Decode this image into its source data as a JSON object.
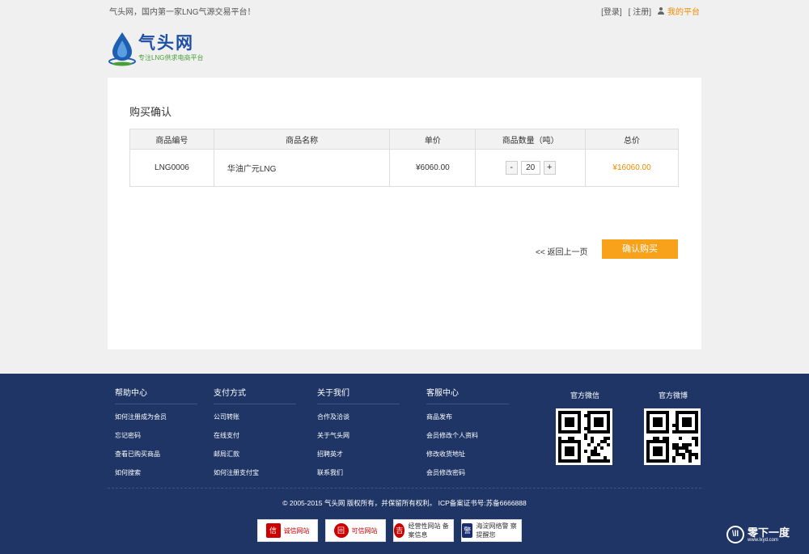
{
  "topbar": {
    "slogan": "气头网，国内第一家LNG气源交易平台！",
    "login": "[登录]",
    "register": "[ 注册]",
    "my_platform": "我的平台"
  },
  "logo": {
    "brand": "气头网",
    "tagline": "专注LNG供求电商平台"
  },
  "order": {
    "title": "购买确认",
    "columns": [
      "商品编号",
      "商品名称",
      "单价",
      "商品数量（吨）",
      "总价"
    ],
    "rows": [
      {
        "code": "LNG0006",
        "name": "华油广元LNG",
        "unit_price": "¥6060.00",
        "quantity": "20",
        "total": "¥16060.00"
      }
    ],
    "decrement": "-",
    "increment": "+",
    "back_label": "<<  返回上一页",
    "confirm_label": "确认购买"
  },
  "footer": {
    "help": {
      "title": "帮助中心",
      "items": [
        "如何注册成为会员",
        "忘记密码",
        "查看已购买商品",
        "如何搜索"
      ]
    },
    "payment": {
      "title": "支付方式",
      "items": [
        "公司转账",
        "在线支付",
        "邮局汇款",
        "如何注册支付宝"
      ]
    },
    "about": {
      "title": "关于我们",
      "items": [
        "合作及洽谈",
        "关于气头网",
        "招聘英才",
        "联系我们"
      ]
    },
    "service": {
      "title": "客服中心",
      "items": [
        "商品发布",
        "会员修改个人资料",
        "修改收货地址",
        "会员修改密码"
      ]
    },
    "wechat_label": "官方微信",
    "weibo_label": "官方微博",
    "copyright": "© 2005-2015 气头网 版权所有，并保留所有权利。   ICP备案证书号:苏备6666888",
    "badges": [
      {
        "icon": "信",
        "label": "诚信网站"
      },
      {
        "icon": "回",
        "label": "可信网站"
      },
      {
        "icon": "吉",
        "label": "经营性网站 备案信息"
      },
      {
        "icon": "警",
        "label": "海淀网络警 察提醒您"
      }
    ]
  },
  "watermark": {
    "icon": "\\ll",
    "text": "零下一度",
    "url": "www.lxyd.com"
  },
  "colors": {
    "accent": "#f7a21a",
    "price_orange": "#f08c00",
    "footer_bg": "#1e3566",
    "brand_blue": "#1f4fa3"
  }
}
